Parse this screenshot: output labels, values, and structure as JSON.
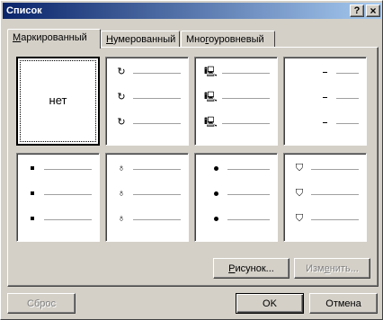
{
  "window": {
    "title": "Список"
  },
  "titlebar": {
    "help": "?",
    "close": "×"
  },
  "tabs": [
    {
      "label_u": "М",
      "label_rest": "аркированный",
      "active": true
    },
    {
      "label_u": "Н",
      "label_rest": "умерованный",
      "active": false
    },
    {
      "label_pre": "Мно",
      "label_u": "г",
      "label_rest": "оуровневый",
      "active": false
    }
  ],
  "bullets": {
    "none_label": "нет",
    "styles": [
      {
        "name": "none",
        "glyph": ""
      },
      {
        "name": "circle-arrow",
        "glyph": "↻"
      },
      {
        "name": "computer",
        "glyph": "🖳"
      },
      {
        "name": "dash",
        "glyph": "-"
      },
      {
        "name": "small-square",
        "glyph": "▪"
      },
      {
        "name": "flame",
        "glyph": "♁"
      },
      {
        "name": "round-dot",
        "glyph": "•"
      },
      {
        "name": "shield",
        "glyph": "⛉"
      }
    ]
  },
  "buttons": {
    "picture_u": "Р",
    "picture_rest": "исунок...",
    "edit_pre": "Изм",
    "edit_u": "е",
    "edit_rest": "нить...",
    "reset": "Сброс",
    "ok": "OK",
    "cancel": "Отмена"
  }
}
